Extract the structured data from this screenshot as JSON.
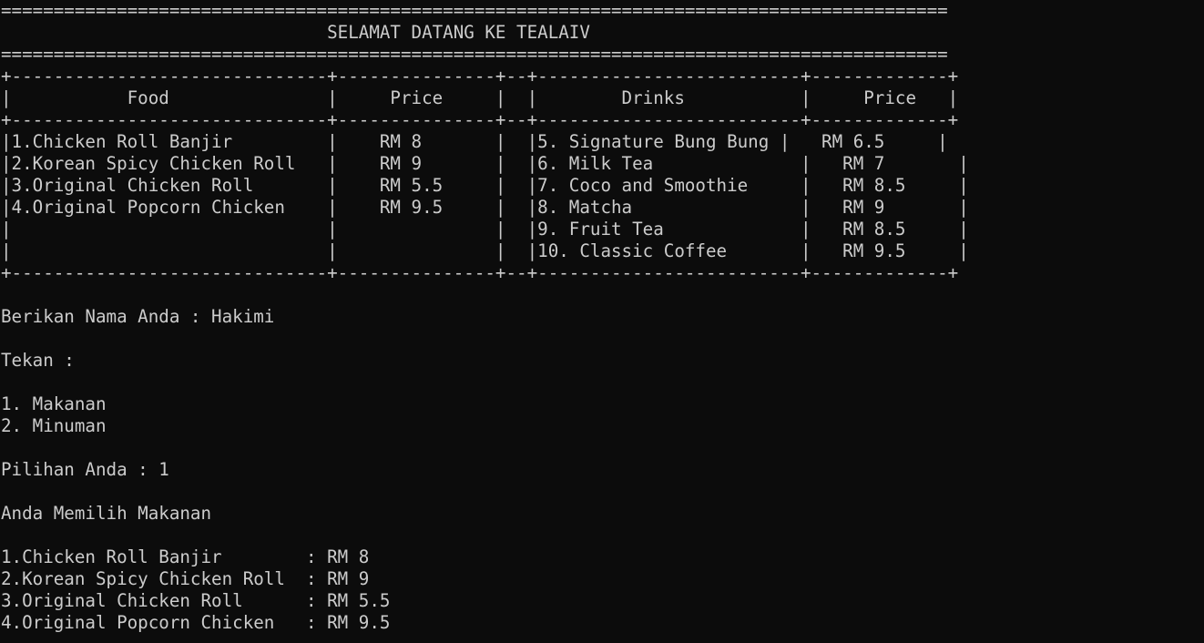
{
  "terminal": {
    "lines": [
      "==========================================================================================",
      "                               SELAMAT DATANG KE TEALAIV",
      "==========================================================================================",
      "+------------------------------+---------------+--+-------------------------+-------------+",
      "|           Food               |     Price     |  |        Drinks           |     Price   |",
      "+------------------------------+---------------+--+-------------------------+-------------+",
      "|1.Chicken Roll Banjir         |    RM 8       |  |5. Signature Bung Bung |   RM 6.5     |",
      "|2.Korean Spicy Chicken Roll   |    RM 9       |  |6. Milk Tea              |   RM 7       |",
      "|3.Original Chicken Roll       |    RM 5.5     |  |7. Coco and Smoothie     |   RM 8.5     |",
      "|4.Original Popcorn Chicken    |    RM 9.5     |  |8. Matcha                |   RM 9       |",
      "|                              |               |  |9. Fruit Tea             |   RM 8.5     |",
      "|                              |               |  |10. Classic Coffee       |   RM 9.5     |",
      "+------------------------------+---------------+--+-------------------------+-------------+",
      "",
      "Berikan Nama Anda : Hakimi",
      "",
      "Tekan :",
      "",
      "1. Makanan",
      "2. Minuman",
      "",
      "Pilihan Anda : 1",
      "",
      "Anda Memilih Makanan",
      "",
      "1.Chicken Roll Banjir        : RM 8",
      "2.Korean Spicy Chicken Roll  : RM 9",
      "3.Original Chicken Roll      : RM 5.5",
      "4.Original Popcorn Chicken   : RM 9.5"
    ]
  },
  "colors": {
    "background": "#0c0c0c",
    "text": "#cccccc"
  }
}
